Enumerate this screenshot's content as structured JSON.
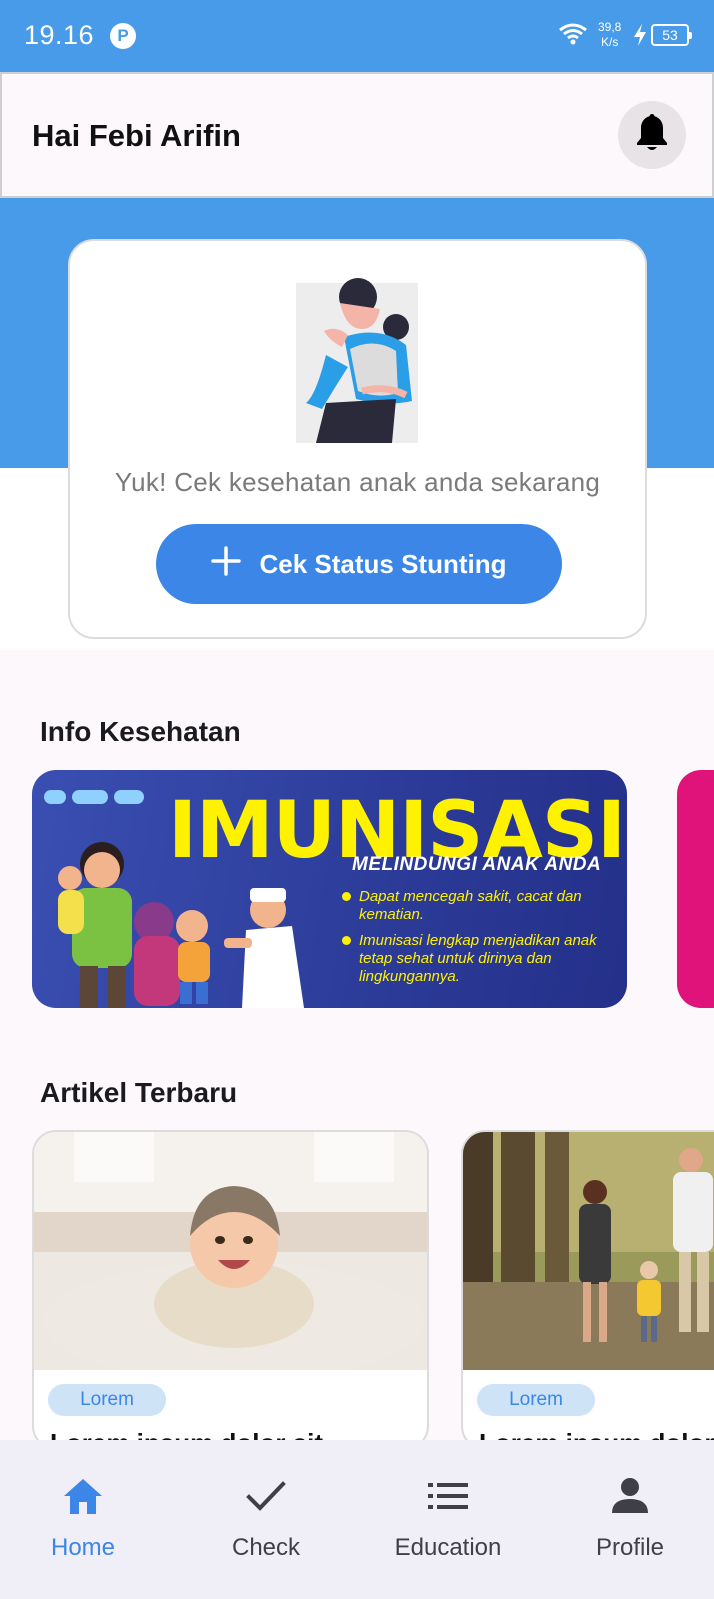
{
  "status_bar": {
    "time": "19.16",
    "badge": "P",
    "net_speed_value": "39,8",
    "net_speed_unit": "K/s",
    "battery": "53"
  },
  "header": {
    "greeting": "Hai Febi Arifin",
    "notification_icon": "bell-icon"
  },
  "hero": {
    "message": "Yuk! Cek kesehatan anak anda sekarang",
    "button_label": "Cek Status Stunting",
    "button_icon": "plus-icon"
  },
  "info_section": {
    "title": "Info Kesehatan",
    "banners": [
      {
        "headline": "IMUNISASI",
        "subheadline": "MELINDUNGI ANAK ANDA",
        "bullets": [
          "Dapat mencegah sakit, cacat dan kematian.",
          "Imunisasi lengkap menjadikan anak tetap sehat untuk dirinya dan lingkungannya."
        ]
      }
    ]
  },
  "articles_section": {
    "title": "Artikel Terbaru",
    "articles": [
      {
        "tag": "Lorem",
        "title": "Lorem ipsum dolor sit"
      },
      {
        "tag": "Lorem",
        "title": "Lorem ipsum dolor"
      }
    ]
  },
  "bottom_nav": {
    "items": [
      {
        "label": "Home",
        "icon": "home-icon",
        "active": true
      },
      {
        "label": "Check",
        "icon": "check-icon",
        "active": false
      },
      {
        "label": "Education",
        "icon": "list-icon",
        "active": false
      },
      {
        "label": "Profile",
        "icon": "person-icon",
        "active": false
      }
    ]
  },
  "colors": {
    "primary": "#479be8",
    "button": "#3b86e6",
    "active_nav": "#3b86e6",
    "banner_headline": "#fff200"
  }
}
